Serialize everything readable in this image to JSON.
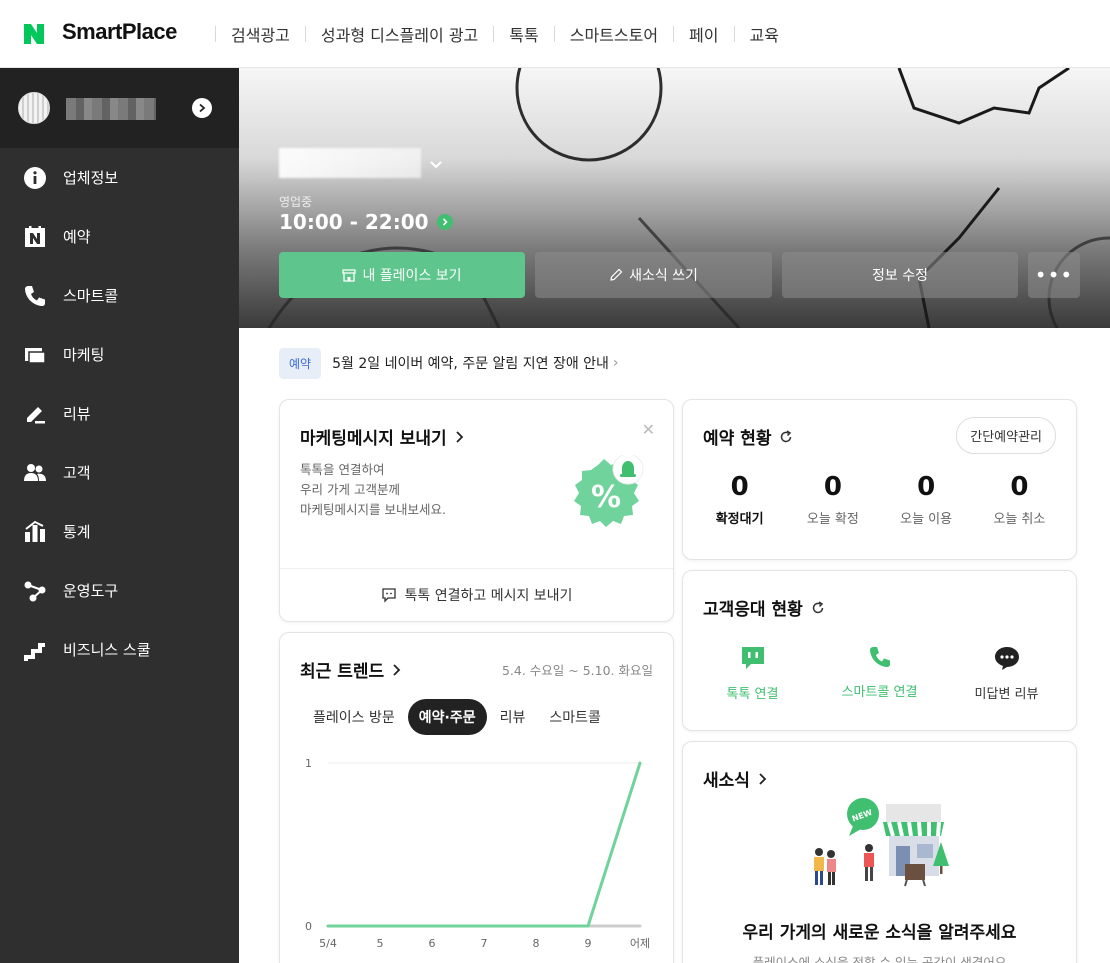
{
  "app": {
    "brand": "SmartPlace"
  },
  "topnav": [
    "검색광고",
    "성과형 디스플레이 광고",
    "톡톡",
    "스마트스토어",
    "페이",
    "교육"
  ],
  "sidebar": {
    "items": [
      {
        "label": "업체정보",
        "icon": "info-icon"
      },
      {
        "label": "예약",
        "icon": "calendar-n-icon"
      },
      {
        "label": "스마트콜",
        "icon": "phone-icon"
      },
      {
        "label": "마케팅",
        "icon": "ads-icon"
      },
      {
        "label": "리뷰",
        "icon": "pen-icon"
      },
      {
        "label": "고객",
        "icon": "users-icon"
      },
      {
        "label": "통계",
        "icon": "stats-icon"
      },
      {
        "label": "운영도구",
        "icon": "share-icon"
      },
      {
        "label": "비즈니스 스쿨",
        "icon": "stairs-icon"
      }
    ]
  },
  "hero": {
    "status": "영업중",
    "hours": "10:00 - 22:00",
    "buttons": {
      "place": "내 플레이스 보기",
      "news": "새소식 쓰기",
      "edit": "정보 수정",
      "more": "•••"
    }
  },
  "notice": {
    "tag": "예약",
    "text": "5월 2일 네이버 예약, 주문 알림 지연 장애 안내"
  },
  "marketing": {
    "title": "마케팅메시지 보내기",
    "desc": [
      "톡톡을 연결하여",
      "우리 가게 고객분께",
      "마케팅메시지를 보내보세요."
    ],
    "footer": "톡톡 연결하고 메시지 보내기"
  },
  "reservation": {
    "title": "예약 현황",
    "button": "간단예약관리",
    "stats": [
      {
        "value": "0",
        "label": "확정대기"
      },
      {
        "value": "0",
        "label": "오늘 확정"
      },
      {
        "value": "0",
        "label": "오늘 이용"
      },
      {
        "value": "0",
        "label": "오늘 취소"
      }
    ]
  },
  "customer": {
    "title": "고객응대 현황",
    "items": [
      {
        "label": "톡톡 연결",
        "color": "#3fbf6f"
      },
      {
        "label": "스마트콜 연결",
        "color": "#3fbf6f"
      },
      {
        "label": "미답변 리뷰",
        "color": "#333333"
      }
    ]
  },
  "trends": {
    "title": "최근 트렌드",
    "range": "5.4. 수요일 ~ 5.10. 화요일",
    "tabs": [
      "플레이스 방문",
      "예약·주문",
      "리뷰",
      "스마트콜"
    ],
    "active_tab": 1
  },
  "news": {
    "title": "새소식",
    "headline": "우리 가게의 새로운 소식을 알려주세요",
    "sub": "플레이스에 소식을 전할 수 있는 공간이 생겼어요"
  },
  "colors": {
    "accent": "#5ec58c",
    "brand_green": "#03c75a",
    "line": "#6fd39b"
  },
  "chart_data": {
    "type": "line",
    "categories": [
      "5/4",
      "5",
      "6",
      "7",
      "8",
      "9",
      "어제"
    ],
    "series": [
      {
        "values": [
          0,
          0,
          0,
          0,
          0,
          0,
          1
        ],
        "color": "#6fd39b"
      },
      {
        "values": [
          0,
          0,
          0,
          0,
          0,
          0,
          0
        ],
        "color": "#cccccc"
      }
    ],
    "ylim": [
      0,
      1
    ],
    "yticks": [
      "0",
      "1"
    ]
  }
}
